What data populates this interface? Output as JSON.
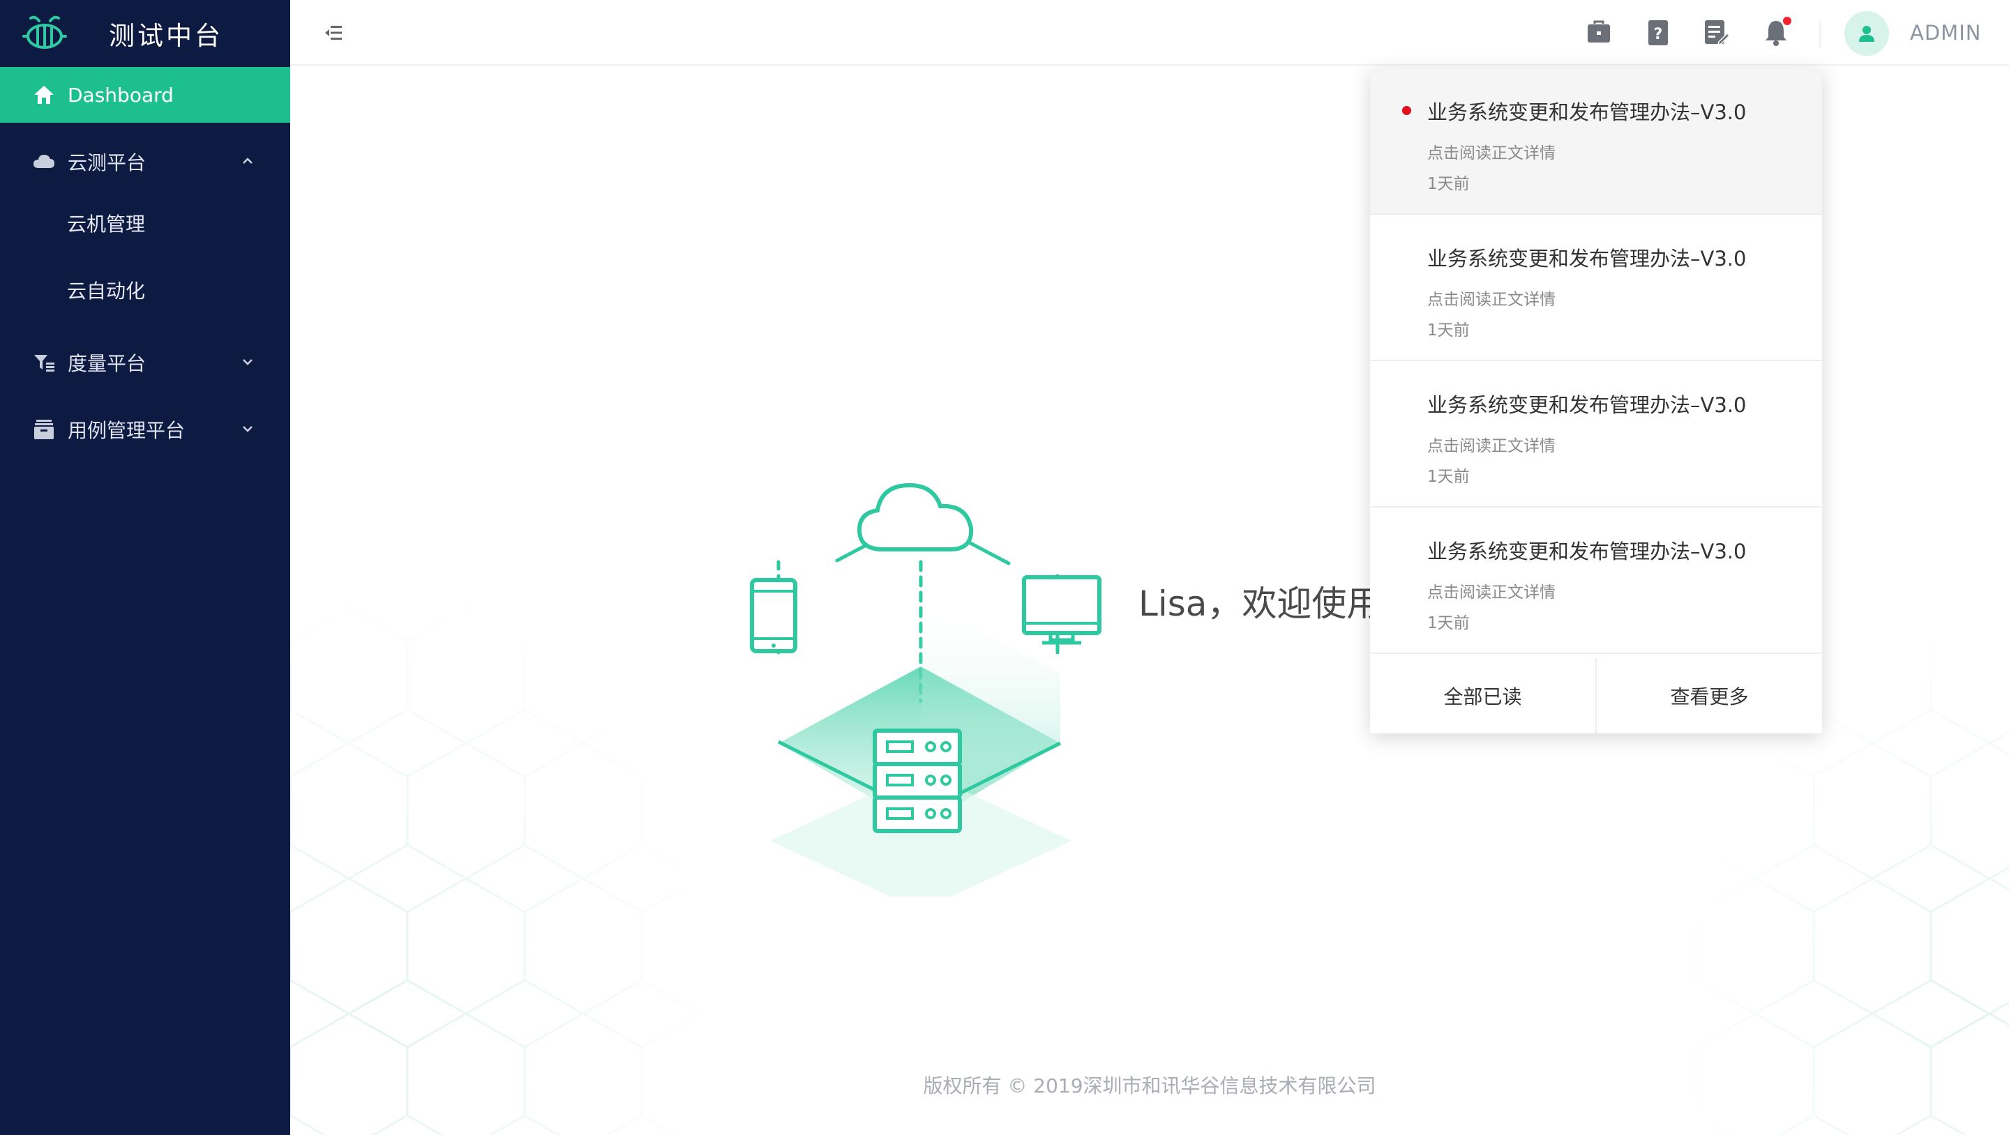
{
  "app": {
    "title": "测试中台"
  },
  "sidebar": {
    "items": [
      {
        "label": "Dashboard",
        "icon": "home-icon",
        "active": true
      },
      {
        "label": "云测平台",
        "icon": "cloud-icon",
        "expanded": true,
        "children": [
          {
            "label": "云机管理"
          },
          {
            "label": "云自动化"
          }
        ]
      },
      {
        "label": "度量平台",
        "icon": "filter-list-icon",
        "expanded": false
      },
      {
        "label": "用例管理平台",
        "icon": "archive-box-icon",
        "expanded": false
      }
    ]
  },
  "header": {
    "icons": [
      "briefcase-icon",
      "help-doc-icon",
      "edit-note-icon",
      "bell-icon"
    ],
    "user": "ADMIN"
  },
  "main": {
    "welcome": "Lisa，欢迎使用",
    "footer": "版权所有 © 2019深圳市和讯华谷信息技术有限公司"
  },
  "notifications": {
    "items": [
      {
        "title": "业务系统变更和发布管理办法–V3.0",
        "subtitle": "点击阅读正文详情",
        "time": "1天前",
        "unread": true
      },
      {
        "title": "业务系统变更和发布管理办法–V3.0",
        "subtitle": "点击阅读正文详情",
        "time": "1天前",
        "unread": false
      },
      {
        "title": "业务系统变更和发布管理办法–V3.0",
        "subtitle": "点击阅读正文详情",
        "time": "1天前",
        "unread": false
      },
      {
        "title": "业务系统变更和发布管理办法–V3.0",
        "subtitle": "点击阅读正文详情",
        "time": "1天前",
        "unread": false
      }
    ],
    "mark_all_read": "全部已读",
    "view_more": "查看更多"
  },
  "colors": {
    "sidebar_bg": "#0d1a42",
    "accent": "#1dbf8e",
    "alert": "#f5222d"
  }
}
